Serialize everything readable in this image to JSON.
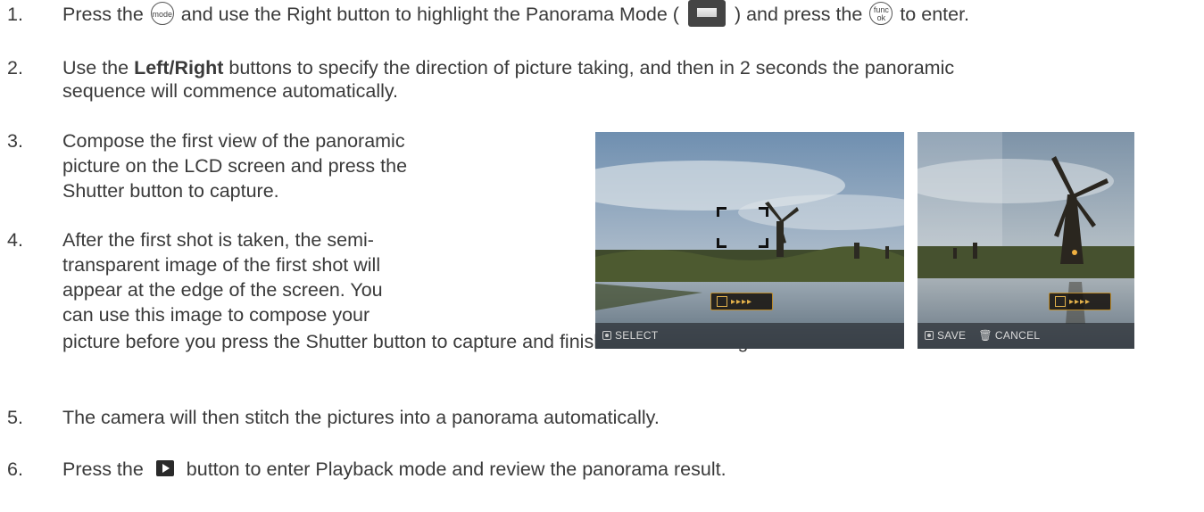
{
  "steps": [
    {
      "num": "1.",
      "a": "Press the",
      "b": "and use the Right button to highlight the Panorama Mode (",
      "c": ") and press the",
      "d": "to enter."
    },
    {
      "num": "2.",
      "a": "Use the",
      "bold": "Left/Right",
      "b": "buttons to specify the direction of picture taking, and then in 2 seconds the panoramic",
      "line2": "sequence will commence automatically."
    },
    {
      "num": "3.",
      "line1": "Compose the first view of the panoramic",
      "line2": "picture on the LCD screen and press the",
      "line3": "Shutter button to capture."
    },
    {
      "num": "4.",
      "line1": "After the first shot is taken, the semi-",
      "line2": "transparent image of the first shot will",
      "line3": "appear at the edge of the screen. You",
      "line4": "can use this image to compose your",
      "line5": "picture before you press the Shutter button to capture and finish manual stitching."
    },
    {
      "num": "5.",
      "text": "The camera will then stitch the pictures into a panorama automatically."
    },
    {
      "num": "6.",
      "a": "Press the",
      "b": "button to enter Playback mode and review the panorama result."
    }
  ],
  "icons": {
    "mode_button": "mode",
    "func_button_top": "func",
    "func_button_bottom": "ok"
  },
  "photos": {
    "left": {
      "status_label": "SELECT",
      "indicator": "▸▸▸▸"
    },
    "right": {
      "save_label": "SAVE",
      "cancel_label": "CANCEL",
      "indicator": "▸▸▸▸"
    }
  },
  "colors": {
    "text": "#3a3a3a",
    "indicator": "#e3b14b"
  }
}
